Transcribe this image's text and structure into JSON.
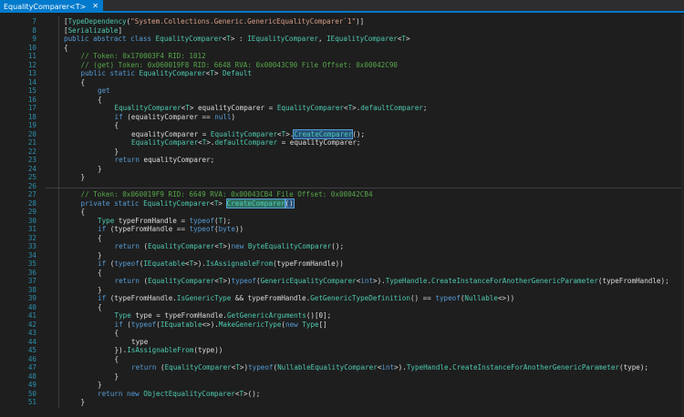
{
  "tab": {
    "title": "EqualityComparer<T>",
    "close_icon": "close-icon"
  },
  "colors": {
    "background": "#1e1e1e",
    "accent": "#007acc",
    "line_number": "#2b91af",
    "keyword": "#569cd6",
    "type": "#4ec9b0",
    "comment": "#57a64a",
    "string": "#d69d85",
    "highlight": "#264f78"
  },
  "lines": [
    {
      "n": "7",
      "indent": 0,
      "tokens": [
        [
          "[",
          "t-plain"
        ],
        [
          "TypeDependency",
          "t-type"
        ],
        [
          "(",
          "t-plain"
        ],
        [
          "\"System.Collections.Generic.GenericEqualityComparer`1\"",
          "t-str"
        ],
        [
          ")]",
          "t-plain"
        ]
      ]
    },
    {
      "n": "8",
      "indent": 0,
      "tokens": [
        [
          "[",
          "t-plain"
        ],
        [
          "Serializable",
          "t-type"
        ],
        [
          "]",
          "t-plain"
        ]
      ]
    },
    {
      "n": "9",
      "indent": 0,
      "tokens": [
        [
          "public abstract class ",
          "t-kw"
        ],
        [
          "EqualityComparer",
          "t-type"
        ],
        [
          "<",
          "t-plain"
        ],
        [
          "T",
          "t-type"
        ],
        [
          "> : ",
          "t-plain"
        ],
        [
          "IEqualityComparer",
          "t-type"
        ],
        [
          ", ",
          "t-plain"
        ],
        [
          "IEqualityComparer",
          "t-type"
        ],
        [
          "<",
          "t-plain"
        ],
        [
          "T",
          "t-type"
        ],
        [
          ">",
          "t-plain"
        ]
      ]
    },
    {
      "n": "10",
      "indent": 0,
      "tokens": [
        [
          "{",
          "t-plain"
        ]
      ]
    },
    {
      "n": "11",
      "indent": 1,
      "tokens": [
        [
          "// Token: 0x170003F4 RID: 1012",
          "t-cm"
        ]
      ]
    },
    {
      "n": "12",
      "indent": 1,
      "tokens": [
        [
          "// (get) Token: 0x060019F8 RID: 6648 RVA: 0x00043C90 File Offset: 0x00042C90",
          "t-cm"
        ]
      ]
    },
    {
      "n": "13",
      "indent": 1,
      "tokens": [
        [
          "public static ",
          "t-kw"
        ],
        [
          "EqualityComparer",
          "t-type"
        ],
        [
          "<",
          "t-plain"
        ],
        [
          "T",
          "t-type"
        ],
        [
          "> ",
          "t-plain"
        ],
        [
          "Default",
          "t-mem"
        ]
      ]
    },
    {
      "n": "14",
      "indent": 1,
      "tokens": [
        [
          "{",
          "t-plain"
        ]
      ]
    },
    {
      "n": "15",
      "indent": 2,
      "tokens": [
        [
          "get",
          "t-kw"
        ]
      ]
    },
    {
      "n": "16",
      "indent": 2,
      "tokens": [
        [
          "{",
          "t-plain"
        ]
      ]
    },
    {
      "n": "17",
      "indent": 3,
      "tokens": [
        [
          "EqualityComparer",
          "t-type"
        ],
        [
          "<",
          "t-plain"
        ],
        [
          "T",
          "t-type"
        ],
        [
          "> equalityComparer = ",
          "t-plain"
        ],
        [
          "EqualityComparer",
          "t-type"
        ],
        [
          "<",
          "t-plain"
        ],
        [
          "T",
          "t-type"
        ],
        [
          ">.",
          "t-plain"
        ],
        [
          "defaultComparer",
          "t-mem"
        ],
        [
          ";",
          "t-plain"
        ]
      ]
    },
    {
      "n": "18",
      "indent": 3,
      "tokens": [
        [
          "if",
          "t-kw"
        ],
        [
          " (equalityComparer == ",
          "t-plain"
        ],
        [
          "null",
          "t-kw"
        ],
        [
          ")",
          "t-plain"
        ]
      ]
    },
    {
      "n": "19",
      "indent": 3,
      "tokens": [
        [
          "{",
          "t-plain"
        ]
      ]
    },
    {
      "n": "20",
      "indent": 4,
      "tokens": [
        [
          "equalityComparer = ",
          "t-plain"
        ],
        [
          "EqualityComparer",
          "t-type"
        ],
        [
          "<",
          "t-plain"
        ],
        [
          "T",
          "t-type"
        ],
        [
          ">.",
          "t-plain"
        ],
        [
          "CreateComparer",
          "t-fn t-hl"
        ],
        [
          "();",
          "t-plain"
        ]
      ]
    },
    {
      "n": "21",
      "indent": 4,
      "tokens": [
        [
          "EqualityComparer",
          "t-type"
        ],
        [
          "<",
          "t-plain"
        ],
        [
          "T",
          "t-type"
        ],
        [
          ">.",
          "t-plain"
        ],
        [
          "defaultComparer",
          "t-mem"
        ],
        [
          " = equalityComparer;",
          "t-plain"
        ]
      ]
    },
    {
      "n": "22",
      "indent": 3,
      "tokens": [
        [
          "}",
          "t-plain"
        ]
      ]
    },
    {
      "n": "23",
      "indent": 3,
      "tokens": [
        [
          "return",
          "t-kw"
        ],
        [
          " equalityComparer;",
          "t-plain"
        ]
      ]
    },
    {
      "n": "24",
      "indent": 2,
      "tokens": [
        [
          "}",
          "t-plain"
        ]
      ]
    },
    {
      "n": "25",
      "indent": 1,
      "tokens": [
        [
          "}",
          "t-plain"
        ]
      ]
    },
    {
      "n": "26",
      "indent": 0,
      "tokens": []
    },
    {
      "n": "27",
      "indent": 1,
      "tokens": [
        [
          "// Token: 0x060019F9 RID: 6649 RVA: 0x00043CB4 File Offset: 0x00042CB4",
          "t-cm"
        ]
      ]
    },
    {
      "n": "28",
      "indent": 1,
      "tokens": [
        [
          "private static ",
          "t-kw"
        ],
        [
          "EqualityComparer",
          "t-type"
        ],
        [
          "<",
          "t-plain"
        ],
        [
          "T",
          "t-type"
        ],
        [
          "> ",
          "t-plain"
        ],
        [
          "CreateComparer",
          "t-fn t-hl2"
        ],
        [
          "()",
          "t-plain t-hl"
        ]
      ]
    },
    {
      "n": "29",
      "indent": 1,
      "tokens": [
        [
          "{",
          "t-plain"
        ]
      ]
    },
    {
      "n": "30",
      "indent": 2,
      "tokens": [
        [
          "Type",
          "t-type"
        ],
        [
          " typeFromHandle = ",
          "t-plain"
        ],
        [
          "typeof",
          "t-kw"
        ],
        [
          "(",
          "t-plain"
        ],
        [
          "T",
          "t-type"
        ],
        [
          ");",
          "t-plain"
        ]
      ]
    },
    {
      "n": "31",
      "indent": 2,
      "tokens": [
        [
          "if",
          "t-kw"
        ],
        [
          " (typeFromHandle == ",
          "t-plain"
        ],
        [
          "typeof",
          "t-kw"
        ],
        [
          "(",
          "t-plain"
        ],
        [
          "byte",
          "t-kw"
        ],
        [
          "))",
          "t-plain"
        ]
      ]
    },
    {
      "n": "32",
      "indent": 2,
      "tokens": [
        [
          "{",
          "t-plain"
        ]
      ]
    },
    {
      "n": "33",
      "indent": 3,
      "tokens": [
        [
          "return",
          "t-kw"
        ],
        [
          " (",
          "t-plain"
        ],
        [
          "EqualityComparer",
          "t-type"
        ],
        [
          "<",
          "t-plain"
        ],
        [
          "T",
          "t-type"
        ],
        [
          ">)",
          "t-plain"
        ],
        [
          "new ",
          "t-kw"
        ],
        [
          "ByteEqualityComparer",
          "t-type"
        ],
        [
          "();",
          "t-plain"
        ]
      ]
    },
    {
      "n": "34",
      "indent": 2,
      "tokens": [
        [
          "}",
          "t-plain"
        ]
      ]
    },
    {
      "n": "35",
      "indent": 2,
      "tokens": [
        [
          "if",
          "t-kw"
        ],
        [
          " (",
          "t-plain"
        ],
        [
          "typeof",
          "t-kw"
        ],
        [
          "(",
          "t-plain"
        ],
        [
          "IEquatable",
          "t-type"
        ],
        [
          "<",
          "t-plain"
        ],
        [
          "T",
          "t-type"
        ],
        [
          ">).",
          "t-plain"
        ],
        [
          "IsAssignableFrom",
          "t-fn"
        ],
        [
          "(typeFromHandle))",
          "t-plain"
        ]
      ]
    },
    {
      "n": "36",
      "indent": 2,
      "tokens": [
        [
          "{",
          "t-plain"
        ]
      ]
    },
    {
      "n": "37",
      "indent": 3,
      "tokens": [
        [
          "return",
          "t-kw"
        ],
        [
          " (",
          "t-plain"
        ],
        [
          "EqualityComparer",
          "t-type"
        ],
        [
          "<",
          "t-plain"
        ],
        [
          "T",
          "t-type"
        ],
        [
          ">)",
          "t-plain"
        ],
        [
          "typeof",
          "t-kw"
        ],
        [
          "(",
          "t-plain"
        ],
        [
          "GenericEqualityComparer",
          "t-type"
        ],
        [
          "<",
          "t-plain"
        ],
        [
          "int",
          "t-kw"
        ],
        [
          ">).",
          "t-plain"
        ],
        [
          "TypeHandle",
          "t-mem"
        ],
        [
          ".",
          "t-plain"
        ],
        [
          "CreateInstanceForAnotherGenericParameter",
          "t-fn"
        ],
        [
          "(typeFromHandle);",
          "t-plain"
        ]
      ]
    },
    {
      "n": "38",
      "indent": 2,
      "tokens": [
        [
          "}",
          "t-plain"
        ]
      ]
    },
    {
      "n": "39",
      "indent": 2,
      "tokens": [
        [
          "if",
          "t-kw"
        ],
        [
          " (typeFromHandle.",
          "t-plain"
        ],
        [
          "IsGenericType",
          "t-mem"
        ],
        [
          " && typeFromHandle.",
          "t-plain"
        ],
        [
          "GetGenericTypeDefinition",
          "t-fn"
        ],
        [
          "() == ",
          "t-plain"
        ],
        [
          "typeof",
          "t-kw"
        ],
        [
          "(",
          "t-plain"
        ],
        [
          "Nullable",
          "t-type"
        ],
        [
          "<>))",
          "t-plain"
        ]
      ]
    },
    {
      "n": "40",
      "indent": 2,
      "tokens": [
        [
          "{",
          "t-plain"
        ]
      ]
    },
    {
      "n": "41",
      "indent": 3,
      "tokens": [
        [
          "Type",
          "t-type"
        ],
        [
          " type = typeFromHandle.",
          "t-plain"
        ],
        [
          "GetGenericArguments",
          "t-fn"
        ],
        [
          "()[0];",
          "t-plain"
        ]
      ]
    },
    {
      "n": "42",
      "indent": 3,
      "tokens": [
        [
          "if",
          "t-kw"
        ],
        [
          " (",
          "t-plain"
        ],
        [
          "typeof",
          "t-kw"
        ],
        [
          "(",
          "t-plain"
        ],
        [
          "IEquatable",
          "t-type"
        ],
        [
          "<>).",
          "t-plain"
        ],
        [
          "MakeGenericType",
          "t-fn"
        ],
        [
          "(",
          "t-plain"
        ],
        [
          "new ",
          "t-kw"
        ],
        [
          "Type",
          "t-type"
        ],
        [
          "[]",
          "t-plain"
        ]
      ]
    },
    {
      "n": "43",
      "indent": 3,
      "tokens": [
        [
          "{",
          "t-plain"
        ]
      ]
    },
    {
      "n": "44",
      "indent": 4,
      "tokens": [
        [
          "type",
          "t-plain"
        ]
      ]
    },
    {
      "n": "45",
      "indent": 3,
      "tokens": [
        [
          "}).",
          "t-plain"
        ],
        [
          "IsAssignableFrom",
          "t-fn"
        ],
        [
          "(type))",
          "t-plain"
        ]
      ]
    },
    {
      "n": "46",
      "indent": 3,
      "tokens": [
        [
          "{",
          "t-plain"
        ]
      ]
    },
    {
      "n": "47",
      "indent": 4,
      "tokens": [
        [
          "return",
          "t-kw"
        ],
        [
          " (",
          "t-plain"
        ],
        [
          "EqualityComparer",
          "t-type"
        ],
        [
          "<",
          "t-plain"
        ],
        [
          "T",
          "t-type"
        ],
        [
          ">)",
          "t-plain"
        ],
        [
          "typeof",
          "t-kw"
        ],
        [
          "(",
          "t-plain"
        ],
        [
          "NullableEqualityComparer",
          "t-type"
        ],
        [
          "<",
          "t-plain"
        ],
        [
          "int",
          "t-kw"
        ],
        [
          ">).",
          "t-plain"
        ],
        [
          "TypeHandle",
          "t-mem"
        ],
        [
          ".",
          "t-plain"
        ],
        [
          "CreateInstanceForAnotherGenericParameter",
          "t-fn"
        ],
        [
          "(type);",
          "t-plain"
        ]
      ]
    },
    {
      "n": "48",
      "indent": 3,
      "tokens": [
        [
          "}",
          "t-plain"
        ]
      ]
    },
    {
      "n": "49",
      "indent": 2,
      "tokens": [
        [
          "}",
          "t-plain"
        ]
      ]
    },
    {
      "n": "50",
      "indent": 2,
      "tokens": [
        [
          "return new ",
          "t-kw"
        ],
        [
          "ObjectEqualityComparer",
          "t-type"
        ],
        [
          "<",
          "t-plain"
        ],
        [
          "T",
          "t-type"
        ],
        [
          ">();",
          "t-plain"
        ]
      ]
    },
    {
      "n": "51",
      "indent": 1,
      "tokens": [
        [
          "}",
          "t-plain"
        ]
      ]
    }
  ]
}
